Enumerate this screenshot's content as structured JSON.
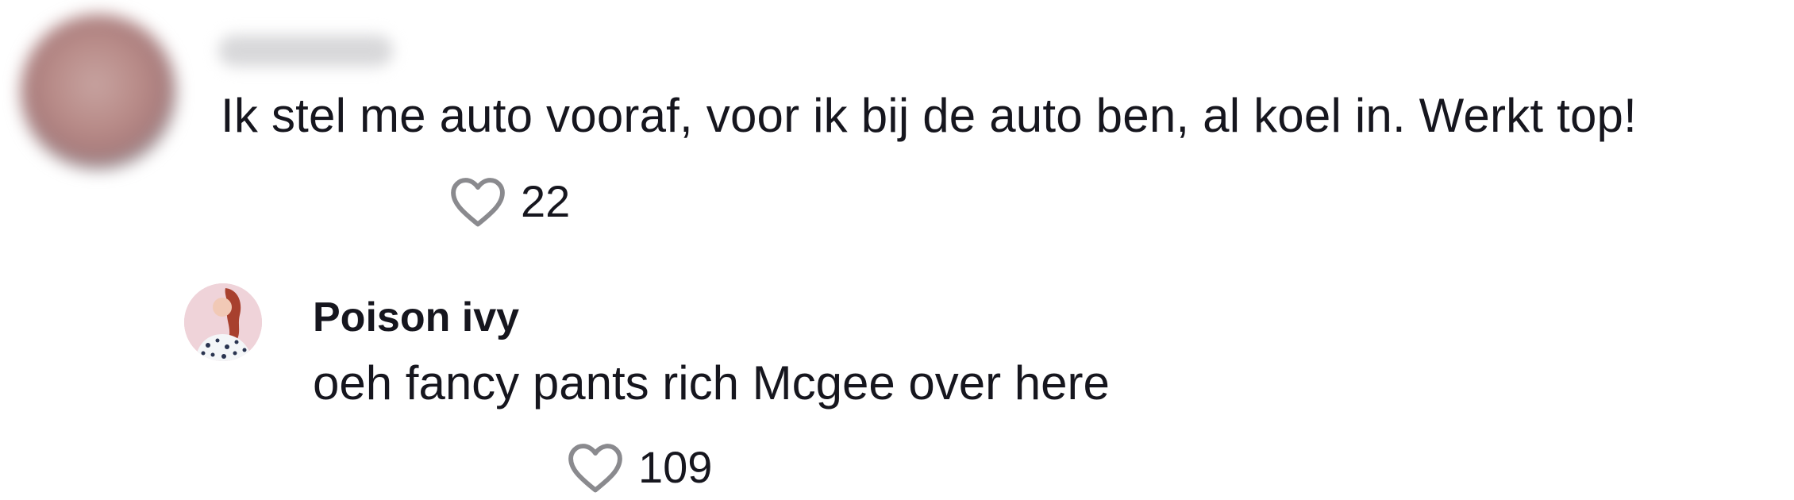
{
  "comment": {
    "username": "",
    "text": "Ik stel me auto vooraf, voor ik bij de auto ben, al koel in. Werkt top!",
    "likes": "22"
  },
  "reply": {
    "author": "Poison ivy",
    "text": "oeh fancy pants rich Mcgee over here",
    "likes": "109"
  },
  "icons": {
    "like": "heart-outline-icon"
  },
  "colors": {
    "text": "#16161e",
    "icon_stroke": "#8a8a8e",
    "background": "#ffffff"
  }
}
